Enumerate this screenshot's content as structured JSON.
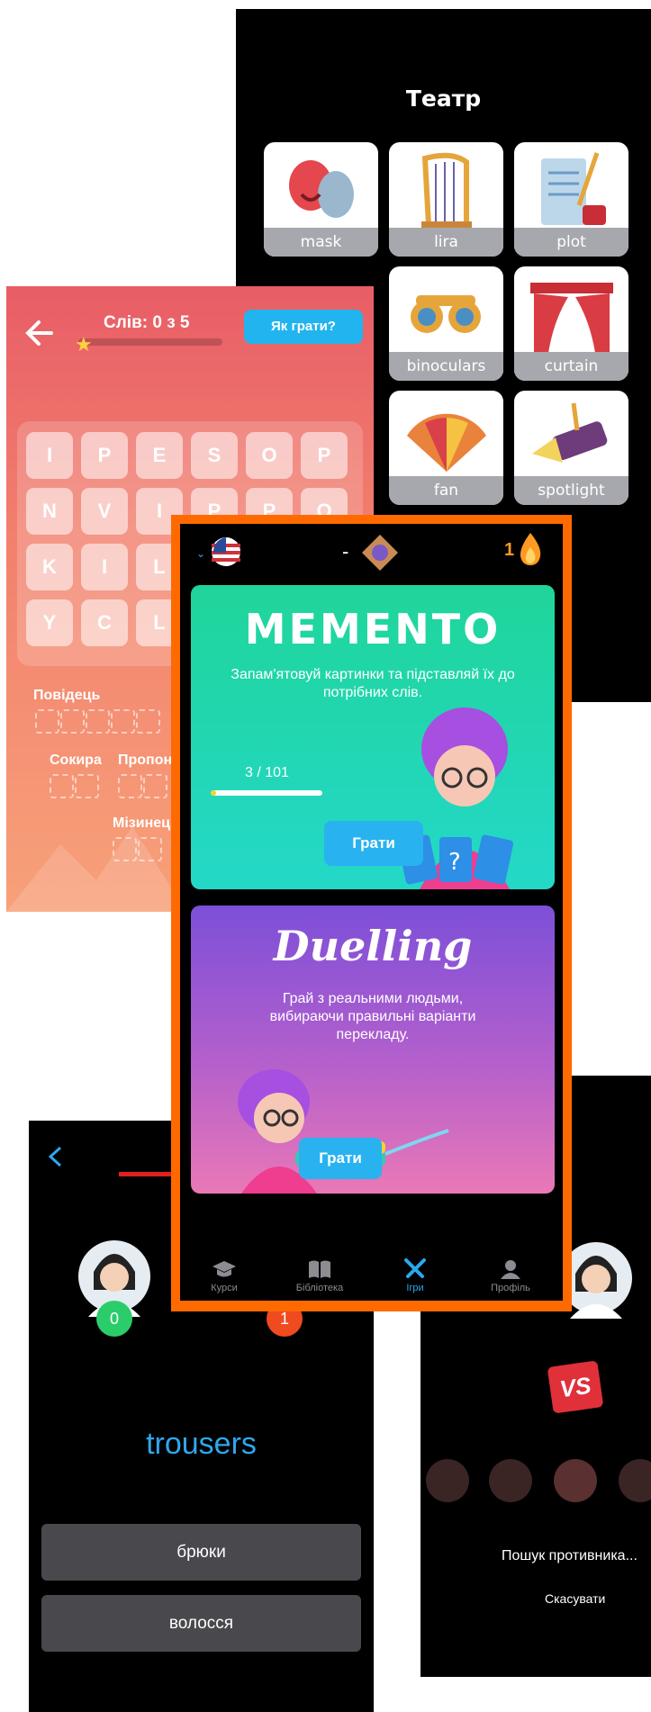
{
  "theatre": {
    "title": "Театр",
    "cards": [
      {
        "label": "mask",
        "icon": "theatre-mask-icon"
      },
      {
        "label": "lira",
        "icon": "harp-icon"
      },
      {
        "label": "plot",
        "icon": "scroll-quill-icon"
      },
      {
        "label": "",
        "icon": "hidden-card-icon"
      },
      {
        "label": "binoculars",
        "icon": "binoculars-icon"
      },
      {
        "label": "curtain",
        "icon": "curtain-icon"
      },
      {
        "label": "",
        "icon": "hidden-card-icon"
      },
      {
        "label": "fan",
        "icon": "fan-icon"
      },
      {
        "label": "spotlight",
        "icon": "spotlight-icon"
      }
    ]
  },
  "puzzle": {
    "counter": "Слів: 0 з 5",
    "howto": "Як грати?",
    "progress": 0,
    "rows": [
      [
        "I",
        "P",
        "E",
        "S",
        "O",
        "P"
      ],
      [
        "N",
        "V",
        "I",
        "P",
        "P",
        "O"
      ],
      [
        "K",
        "I",
        "L",
        "",
        "",
        ""
      ],
      [
        "Y",
        "C",
        "L",
        "",
        "",
        ""
      ]
    ],
    "words": {
      "w1": "Повідець",
      "w2": "Сокира",
      "w3": "Пропон",
      "w4": "Мізинец"
    }
  },
  "duel": {
    "score_left": "0",
    "score_right": "1",
    "word": "trousers",
    "answers": [
      "брюки",
      "волосся"
    ]
  },
  "search": {
    "vs": "VS",
    "status": "Пошук противника...",
    "cancel": "Скасувати"
  },
  "main": {
    "topbar": {
      "language": "us-flag",
      "separator": "-",
      "streak": "1"
    },
    "memento": {
      "title": "MEMENTO",
      "desc": "Запам'ятовуй картинки та підставляй їх до потрібних слів.",
      "progress_text": "3 / 101",
      "progress": 0.03,
      "play": "Грати"
    },
    "duelling": {
      "title": "Duelling",
      "desc": "Грай з реальними людьми, вибираючи правильні варіанти перекладу.",
      "play": "Грати"
    },
    "tabs": [
      {
        "label": "Курси",
        "icon": "graduation-cap-icon"
      },
      {
        "label": "Бібліотека",
        "icon": "book-icon"
      },
      {
        "label": "Ігри",
        "icon": "swords-icon"
      },
      {
        "label": "Профіль",
        "icon": "user-icon"
      }
    ],
    "colors": {
      "active_tab": "#29a9ec",
      "frame": "#ff6a00"
    }
  }
}
